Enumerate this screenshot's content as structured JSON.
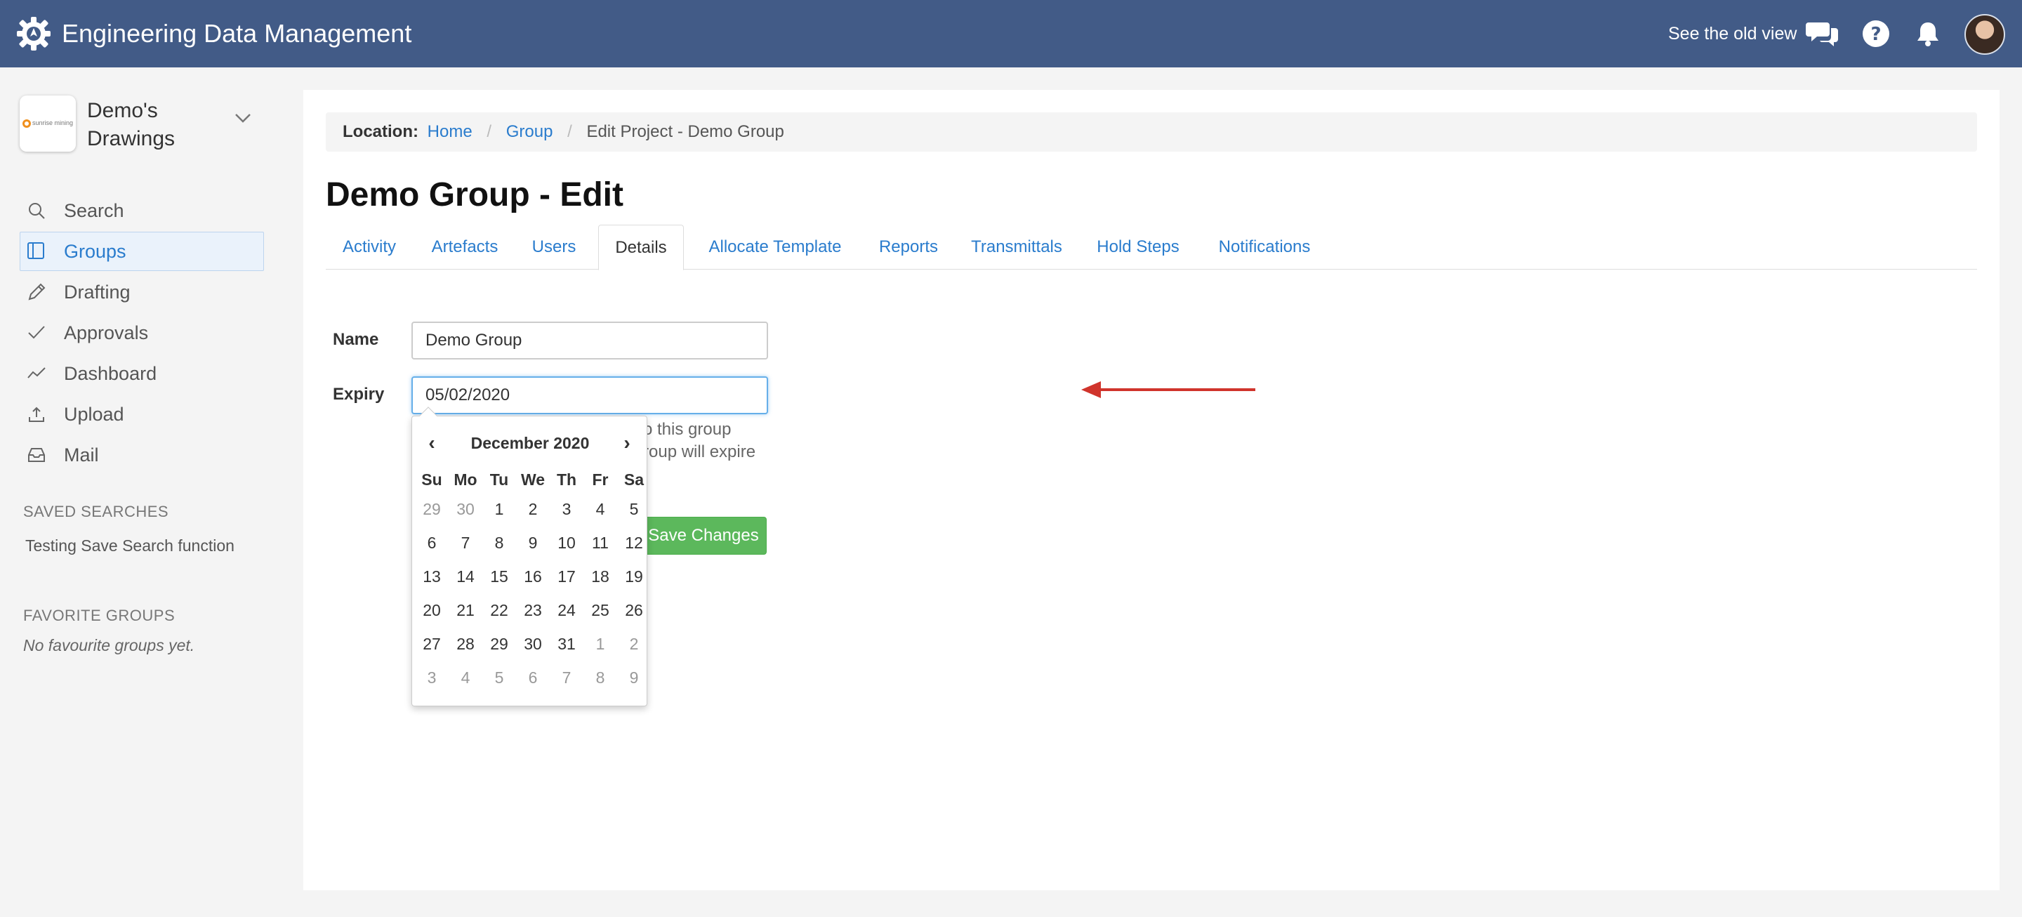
{
  "topbar": {
    "title": "Engineering Data Management",
    "old_view_link": "See the old view",
    "icons": [
      "chat-icon",
      "help-icon",
      "bell-icon",
      "user-avatar"
    ]
  },
  "sidebar": {
    "org_name": "Demo's Drawings",
    "org_logo_text": "sunrise mining",
    "items": [
      {
        "label": "Search",
        "icon": "search-icon"
      },
      {
        "label": "Groups",
        "icon": "book-icon",
        "active": true
      },
      {
        "label": "Drafting",
        "icon": "pencil-icon"
      },
      {
        "label": "Approvals",
        "icon": "check-icon"
      },
      {
        "label": "Dashboard",
        "icon": "trend-icon"
      },
      {
        "label": "Upload",
        "icon": "upload-icon"
      },
      {
        "label": "Mail",
        "icon": "inbox-icon"
      }
    ],
    "saved_searches_title": "SAVED SEARCHES",
    "saved_searches": [
      "Testing Save Search function"
    ],
    "favorite_groups_title": "FAVORITE GROUPS",
    "favorite_groups_empty": "No favourite groups yet."
  },
  "breadcrumb": {
    "label": "Location:",
    "items": [
      "Home",
      "Group",
      "Edit Project - Demo Group"
    ]
  },
  "page_title": "Demo Group - Edit",
  "tabs": [
    "Activity",
    "Artefacts",
    "Users",
    "Details",
    "Allocate Template",
    "Reports",
    "Transmittals",
    "Hold Steps",
    "Notifications"
  ],
  "active_tab": "Details",
  "form": {
    "name_label": "Name",
    "name_value": "Demo Group",
    "expiry_label": "Expiry",
    "expiry_value": "05/02/2020",
    "help_lines": [
      "o this group",
      "roup will expire",
      "."
    ],
    "save_label": "Save Changes"
  },
  "datepicker": {
    "prev": "‹",
    "next": "›",
    "month": "December 2020",
    "weekdays": [
      "Su",
      "Mo",
      "Tu",
      "We",
      "Th",
      "Fr",
      "Sa"
    ],
    "weeks": [
      [
        {
          "d": "29",
          "m": true
        },
        {
          "d": "30",
          "m": true
        },
        {
          "d": "1"
        },
        {
          "d": "2"
        },
        {
          "d": "3"
        },
        {
          "d": "4"
        },
        {
          "d": "5"
        }
      ],
      [
        {
          "d": "6"
        },
        {
          "d": "7"
        },
        {
          "d": "8"
        },
        {
          "d": "9"
        },
        {
          "d": "10"
        },
        {
          "d": "11"
        },
        {
          "d": "12"
        }
      ],
      [
        {
          "d": "13"
        },
        {
          "d": "14"
        },
        {
          "d": "15"
        },
        {
          "d": "16"
        },
        {
          "d": "17"
        },
        {
          "d": "18"
        },
        {
          "d": "19"
        }
      ],
      [
        {
          "d": "20"
        },
        {
          "d": "21"
        },
        {
          "d": "22"
        },
        {
          "d": "23"
        },
        {
          "d": "24"
        },
        {
          "d": "25"
        },
        {
          "d": "26"
        }
      ],
      [
        {
          "d": "27"
        },
        {
          "d": "28"
        },
        {
          "d": "29"
        },
        {
          "d": "30"
        },
        {
          "d": "31"
        },
        {
          "d": "1",
          "m": true
        },
        {
          "d": "2",
          "m": true
        }
      ],
      [
        {
          "d": "3",
          "m": true
        },
        {
          "d": "4",
          "m": true
        },
        {
          "d": "5",
          "m": true
        },
        {
          "d": "6",
          "m": true
        },
        {
          "d": "7",
          "m": true
        },
        {
          "d": "8",
          "m": true
        },
        {
          "d": "9",
          "m": true
        }
      ]
    ]
  },
  "colors": {
    "topbar": "#425b87",
    "link": "#2a7ccd",
    "save_button": "#5cb85c",
    "arrow": "#d0342c"
  }
}
